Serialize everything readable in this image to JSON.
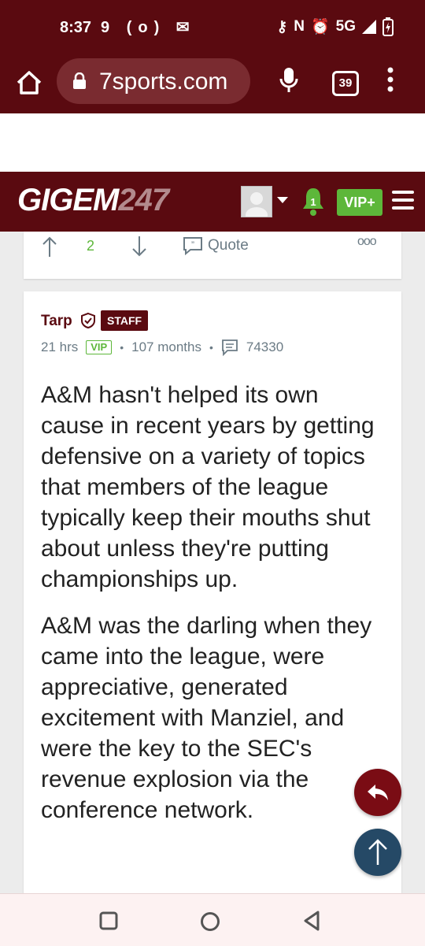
{
  "status_bar": {
    "time": "8:37",
    "left_icons": [
      "nine-icon",
      "radio-icon",
      "mail-icon"
    ],
    "network": "5G",
    "right_icons": [
      "key-icon",
      "nfc-icon",
      "alarm-icon",
      "signal-icon",
      "battery-icon"
    ]
  },
  "browser": {
    "url": "7sports.com",
    "tab_count": "39"
  },
  "site": {
    "logo_text": "GIGEM",
    "logo_number": "247",
    "notification_count": "1",
    "vip_label": "VIP+"
  },
  "prev_post": {
    "votes": "2",
    "quote_label": "Quote",
    "more_label": "ooo"
  },
  "post": {
    "author": "Tarp",
    "badge": "STAFF",
    "time_ago": "21 hrs",
    "vip_tag": "VIP",
    "tenure": "107 months",
    "post_count": "74330",
    "paragraphs": [
      "A&M hasn't helped its own cause in recent years by getting defensive on a variety of topics that members of the league typically keep their mouths shut about unless they're putting championships up.",
      "A&M was the darling when they came into the league, were appreciative, generated excitement with Manziel, and were the key to the SEC's revenue explosion via the conference network."
    ]
  },
  "colors": {
    "maroon": "#5a0a10",
    "vip_green": "#5db73a",
    "fab_reply": "#7a0c14",
    "fab_top": "#254966"
  }
}
